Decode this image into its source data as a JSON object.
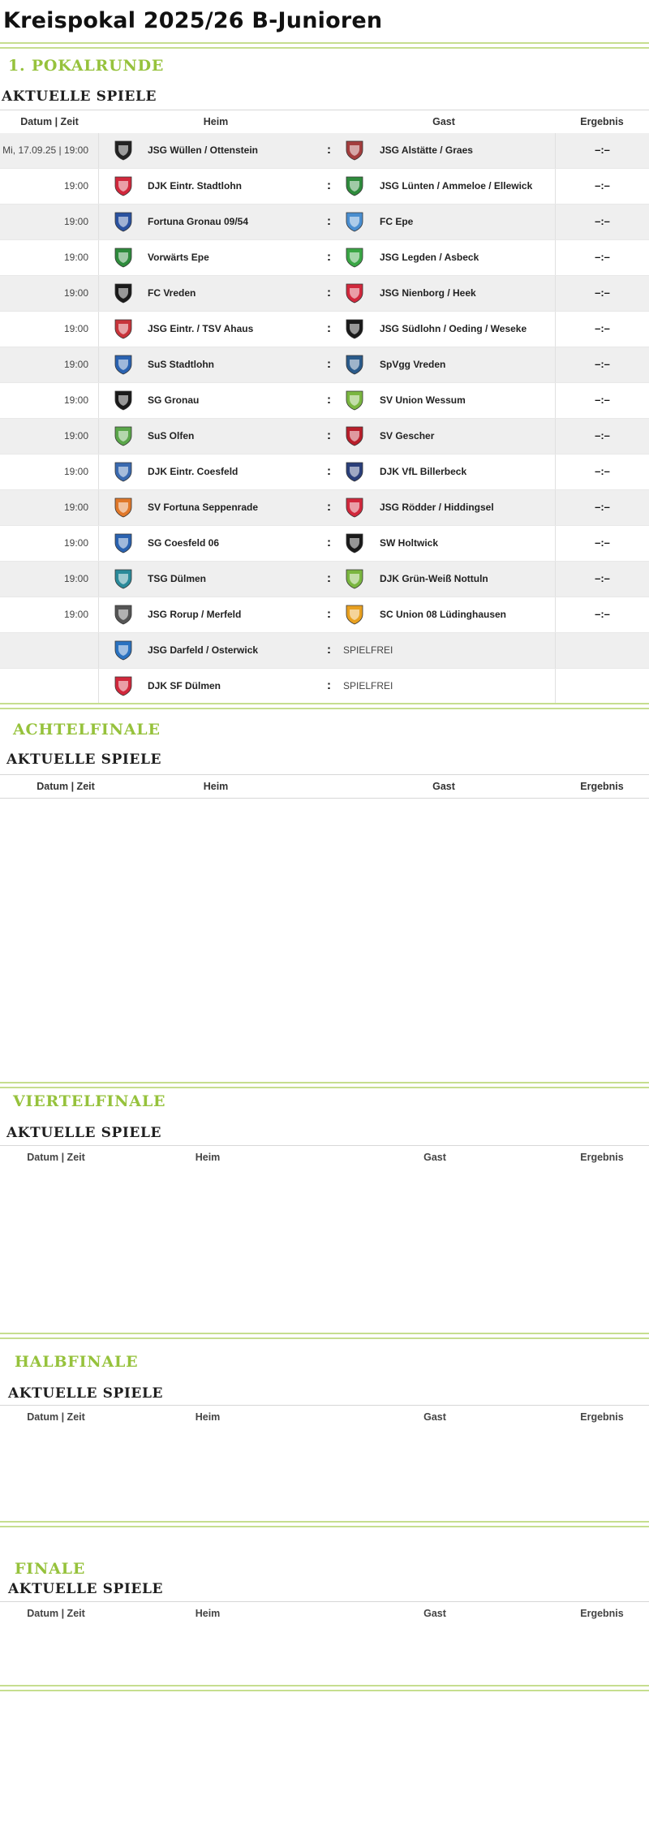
{
  "page_title": "Kreispokal 2025/26 B-Junioren",
  "columns": {
    "date_time": "Datum | Zeit",
    "home": "Heim",
    "away": "Gast",
    "result": "Ergebnis"
  },
  "subheading": "AKTUELLE SPIELE",
  "rounds": [
    {
      "title": "1. POKALRUNDE"
    },
    {
      "title": "ACHTELFINALE"
    },
    {
      "title": "VIERTELFINALE"
    },
    {
      "title": "HALBFINALE"
    },
    {
      "title": "FINALE"
    }
  ],
  "matches": [
    {
      "date": "Mi, 17.09.25",
      "time": "19:00",
      "home": "JSG Wüllen / Ottenstein",
      "away": "JSG Alstätte / Graes",
      "result": "–:–",
      "home_color": "#222222",
      "away_color": "#a33d3d"
    },
    {
      "date": "",
      "time": "19:00",
      "home": "DJK Eintr. Stadtlohn",
      "away": "JSG Lünten / Ammeloe / Ellewick",
      "result": "–:–",
      "home_color": "#d1283c",
      "away_color": "#2e8b3c"
    },
    {
      "date": "",
      "time": "19:00",
      "home": "Fortuna Gronau 09/54",
      "away": "FC Epe",
      "result": "–:–",
      "home_color": "#2a52a0",
      "away_color": "#4a8ed0"
    },
    {
      "date": "",
      "time": "19:00",
      "home": "Vorwärts Epe",
      "away": "JSG Legden / Asbeck",
      "result": "–:–",
      "home_color": "#2e8b3c",
      "away_color": "#3aa645"
    },
    {
      "date": "",
      "time": "19:00",
      "home": "FC Vreden",
      "away": "JSG Nienborg / Heek",
      "result": "–:–",
      "home_color": "#1a1a1a",
      "away_color": "#d1283c"
    },
    {
      "date": "",
      "time": "19:00",
      "home": "JSG Eintr. / TSV Ahaus",
      "away": "JSG Südlohn / Oeding / Weseke",
      "result": "–:–",
      "home_color": "#c8343a",
      "away_color": "#1a1a1a"
    },
    {
      "date": "",
      "time": "19:00",
      "home": "SuS Stadtlohn",
      "away": "SpVgg Vreden",
      "result": "–:–",
      "home_color": "#2a62b0",
      "away_color": "#2a5a8a"
    },
    {
      "date": "",
      "time": "19:00",
      "home": "SG Gronau",
      "away": "SV Union Wessum",
      "result": "–:–",
      "home_color": "#1a1a1a",
      "away_color": "#7ab640"
    },
    {
      "date": "",
      "time": "19:00",
      "home": "SuS Olfen",
      "away": "SV Gescher",
      "result": "–:–",
      "home_color": "#5aa64a",
      "away_color": "#b81e2a"
    },
    {
      "date": "",
      "time": "19:00",
      "home": "DJK Eintr. Coesfeld",
      "away": "DJK VfL Billerbeck",
      "result": "–:–",
      "home_color": "#3a6ab0",
      "away_color": "#2a3f7a"
    },
    {
      "date": "",
      "time": "19:00",
      "home": "SV Fortuna Seppenrade",
      "away": "JSG Rödder / Hiddingsel",
      "result": "–:–",
      "home_color": "#e0782a",
      "away_color": "#d1283c"
    },
    {
      "date": "",
      "time": "19:00",
      "home": "SG Coesfeld 06",
      "away": "SW Holtwick",
      "result": "–:–",
      "home_color": "#2a62b0",
      "away_color": "#1a1a1a"
    },
    {
      "date": "",
      "time": "19:00",
      "home": "TSG Dülmen",
      "away": "DJK Grün-Weiß Nottuln",
      "result": "–:–",
      "home_color": "#2a8a9a",
      "away_color": "#7ab640"
    },
    {
      "date": "",
      "time": "19:00",
      "home": "JSG Rorup / Merfeld",
      "away": "SC Union 08 Lüdinghausen",
      "result": "–:–",
      "home_color": "#555555",
      "away_color": "#e8a020"
    }
  ],
  "byes": [
    {
      "home": "JSG Darfeld / Osterwick",
      "label": "SPIELFREI",
      "home_color": "#2a72c0"
    },
    {
      "home": "DJK SF Dülmen",
      "label": "SPIELFREI",
      "home_color": "#d1283c"
    }
  ]
}
